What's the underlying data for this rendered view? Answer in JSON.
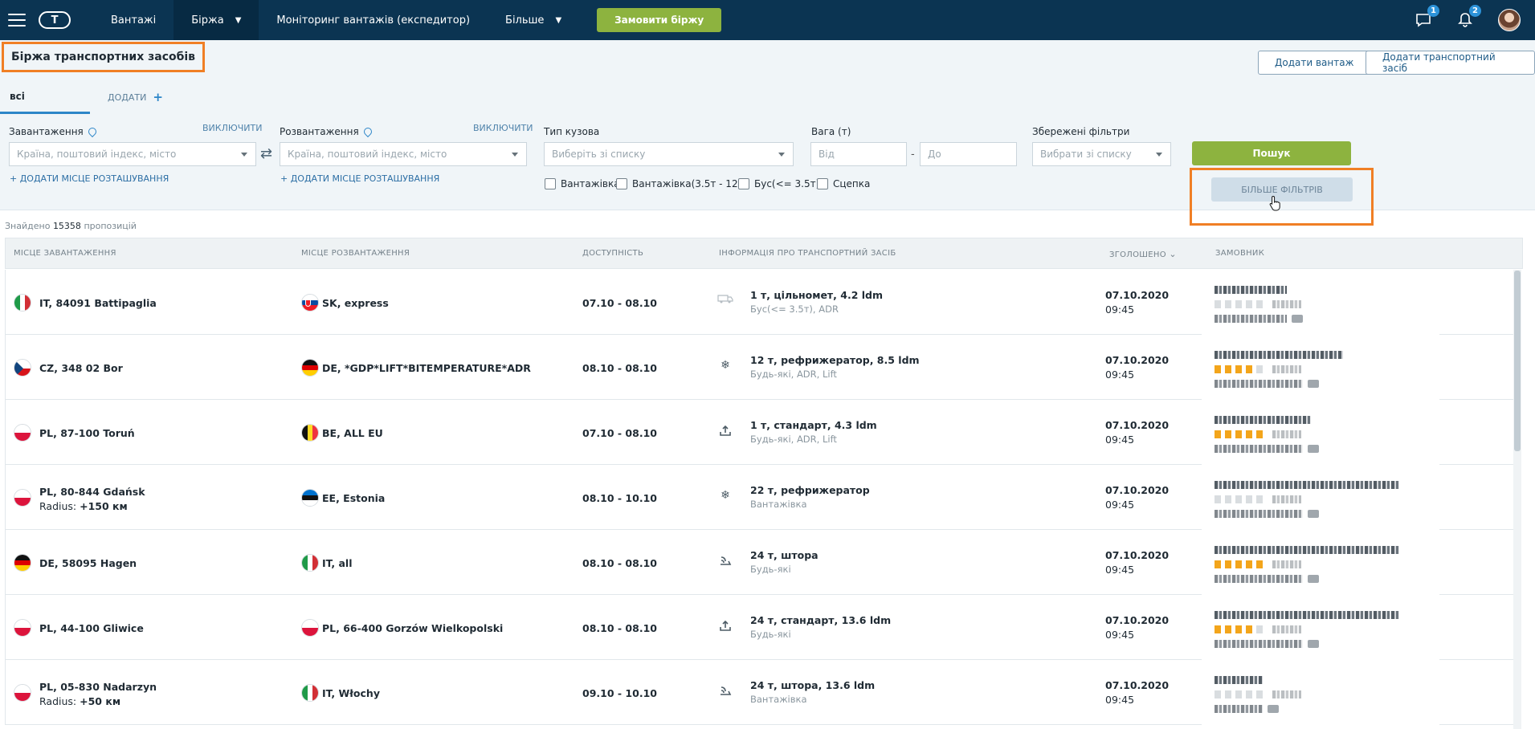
{
  "nav": {
    "items": [
      "Вантажі",
      "Біржа",
      "Моніторинг вантажів (експедитор)",
      "Більше"
    ],
    "order_button": "Замовити біржу",
    "messages_count": "1",
    "notifications_count": "2"
  },
  "page": {
    "title": "Біржа транспортних засобів",
    "add_cargo": "Додати вантаж",
    "add_vehicle": "Додати транспортний засіб",
    "tab_all": "всі",
    "tab_add": "ДОДАТИ"
  },
  "filters": {
    "loading_label": "Завантаження",
    "unloading_label": "Розвантаження",
    "exclude": "ВИКЛЮЧИТИ",
    "location_placeholder": "Країна, поштовий індекс, місто",
    "add_location": "+ ДОДАТИ МІСЦЕ РОЗТАШУВАННЯ",
    "body_type_label": "Тип кузова",
    "body_type_placeholder": "Виберіть зі списку",
    "weight_label": "Вага (т)",
    "weight_from": "Від",
    "weight_to": "До",
    "saved_label": "Збережені фільтри",
    "saved_placeholder": "Вибрати зі списку",
    "search": "Пошук",
    "more_filters": "БІЛЬШЕ ФІЛЬТРІВ",
    "checkboxes": [
      "Вантажівка",
      "Вантажівка(3.5т - 12т)",
      "Бус(<= 3.5т)",
      "Сцепка"
    ]
  },
  "results": {
    "prefix": "Знайдено",
    "count": "15358",
    "suffix": "пропозицій"
  },
  "table": {
    "headers": [
      "МІСЦЕ ЗАВАНТАЖЕННЯ",
      "МІСЦЕ РОЗВАНТАЖЕННЯ",
      "ДОСТУПНІСТЬ",
      "ІНФОРМАЦІЯ ПРО ТРАНСПОРТНИЙ ЗАСІБ",
      "ЗГОЛОШЕНО",
      "ЗАМОВНИК"
    ],
    "rows": [
      {
        "from_flag": "it",
        "from": "IT, 84091 Battipaglia",
        "radius_label": "",
        "radius_value": "",
        "to_flag": "sk",
        "to": "SK, express",
        "avail": "07.10 - 08.10",
        "vicon": "bus-icon",
        "vinfo": "1 т, цільномет, 4.2 ldm",
        "vsub": "Бус(<= 3.5т), ADR",
        "date": "07.10.2020",
        "time": "09:45",
        "rating": 0
      },
      {
        "from_flag": "cz",
        "from": "CZ, 348 02 Bor",
        "radius_label": "",
        "radius_value": "",
        "to_flag": "de",
        "to": "DE, *GDP*LIFT*BITEMPERATURE*ADR",
        "avail": "08.10 - 08.10",
        "vicon": "snowflake-icon",
        "vinfo": "12 т, рефрижератор, 8.5 ldm",
        "vsub": "Будь-які, ADR, Lift",
        "date": "07.10.2020",
        "time": "09:45",
        "rating": 4
      },
      {
        "from_flag": "pl",
        "from": "PL, 87-100 Toruń",
        "radius_label": "",
        "radius_value": "",
        "to_flag": "be",
        "to": "BE, ALL EU",
        "avail": "07.10 - 08.10",
        "vicon": "upload-icon",
        "vinfo": "1 т, стандарт, 4.3 ldm",
        "vsub": "Будь-які, ADR, Lift",
        "date": "07.10.2020",
        "time": "09:45",
        "rating": 5
      },
      {
        "from_flag": "pl",
        "from": "PL, 80-844 Gdańsk",
        "radius_label": "Radius:",
        "radius_value": "+150 км",
        "to_flag": "ee",
        "to": "EE, Estonia",
        "avail": "08.10 - 10.10",
        "vicon": "snowflake-icon",
        "vinfo": "22 т, рефрижератор",
        "vsub": "Вантажівка",
        "date": "07.10.2020",
        "time": "09:45",
        "rating": 0
      },
      {
        "from_flag": "de",
        "from": "DE, 58095 Hagen",
        "radius_label": "",
        "radius_value": "",
        "to_flag": "it",
        "to": "IT, all",
        "avail": "08.10 - 08.10",
        "vicon": "curtain-icon",
        "vinfo": "24 т, штора",
        "vsub": "Будь-які",
        "date": "07.10.2020",
        "time": "09:45",
        "rating": 5
      },
      {
        "from_flag": "pl",
        "from": "PL, 44-100 Gliwice",
        "radius_label": "",
        "radius_value": "",
        "to_flag": "pl",
        "to": "PL, 66-400 Gorzów Wielkopolski",
        "avail": "08.10 - 08.10",
        "vicon": "upload-icon",
        "vinfo": "24 т, стандарт, 13.6 ldm",
        "vsub": "Будь-які",
        "date": "07.10.2020",
        "time": "09:45",
        "rating": 4
      },
      {
        "from_flag": "pl",
        "from": "PL, 05-830 Nadarzyn",
        "radius_label": "Radius:",
        "radius_value": "+50 км",
        "to_flag": "it",
        "to": "IT, Włochy",
        "avail": "09.10 - 10.10",
        "vicon": "curtain-icon",
        "vinfo": "24 т, штора, 13.6 ldm",
        "vsub": "Вантажівка",
        "date": "07.10.2020",
        "time": "09:45",
        "rating": 0
      }
    ]
  },
  "colors": {
    "topbar": "#0b3452",
    "accent_green": "#8db33f",
    "highlight_orange": "#f07f25",
    "link_blue": "#2d86c8"
  }
}
